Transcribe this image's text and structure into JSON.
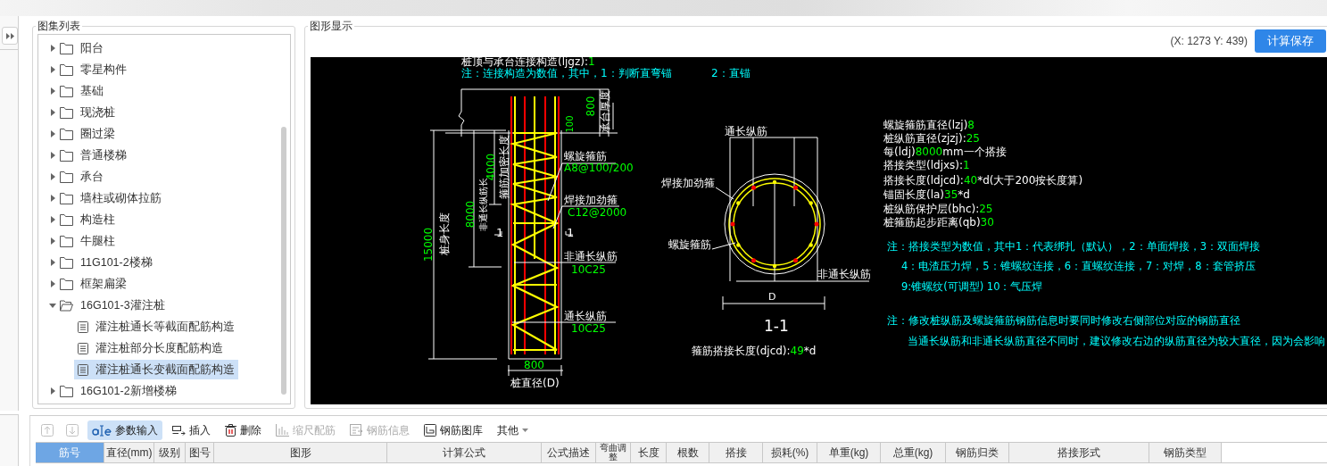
{
  "tree_panel": {
    "title": "图集列表",
    "items": [
      {
        "label": "阳台",
        "expanded": false,
        "selected": false
      },
      {
        "label": "零星构件",
        "expanded": false,
        "selected": false
      },
      {
        "label": "基础",
        "expanded": false,
        "selected": false
      },
      {
        "label": "现浇桩",
        "expanded": false,
        "selected": false
      },
      {
        "label": "圈过梁",
        "expanded": false,
        "selected": false
      },
      {
        "label": "普通楼梯",
        "expanded": false,
        "selected": false
      },
      {
        "label": "承台",
        "expanded": false,
        "selected": false
      },
      {
        "label": "墙柱或砌体拉筋",
        "expanded": false,
        "selected": false
      },
      {
        "label": "构造柱",
        "expanded": false,
        "selected": false
      },
      {
        "label": "牛腿柱",
        "expanded": false,
        "selected": false
      },
      {
        "label": "11G101-2楼梯",
        "expanded": false,
        "selected": false
      },
      {
        "label": "框架扁梁",
        "expanded": false,
        "selected": false
      },
      {
        "label": "16G101-3灌注桩",
        "expanded": true,
        "selected": false,
        "children": [
          {
            "label": "灌注桩通长等截面配筋构造",
            "selected": false
          },
          {
            "label": "灌注桩部分长度配筋构造",
            "selected": false
          },
          {
            "label": "灌注桩通长变截面配筋构造",
            "selected": true
          }
        ]
      },
      {
        "label": "16G101-2新增楼梯",
        "expanded": false,
        "selected": false
      }
    ]
  },
  "graphic_panel": {
    "title": "图形显示",
    "coordinates": "(X: 1273 Y: 439)",
    "save_button": "计算保存",
    "drawing": {
      "top_param": {
        "label": "桩顶与承台连接构造(ljgz):",
        "value": "1"
      },
      "top_note": [
        "注：连接构造为数值，其中，1：判断直弯锚",
        "2：直锚"
      ],
      "elevation_labels": [
        {
          "text": "800",
          "kind": "dim"
        },
        {
          "text": "承台厚度",
          "kind": "text"
        },
        {
          "text": "100",
          "kind": "dim"
        },
        {
          "text": "箍筋加密长度",
          "kind": "text"
        },
        {
          "text": "4000",
          "kind": "dim"
        },
        {
          "text": "非通长纵筋长",
          "kind": "text"
        },
        {
          "text": "8000",
          "kind": "dim"
        },
        {
          "text": "桩身长度",
          "kind": "text"
        },
        {
          "text": "15000",
          "kind": "dim"
        },
        {
          "text": "螺旋箍筋",
          "kind": "text"
        },
        {
          "text": "A8@100/200",
          "kind": "dim"
        },
        {
          "text": "焊接加劲箍",
          "kind": "text"
        },
        {
          "text": "C12@2000",
          "kind": "dim"
        },
        {
          "text": "1",
          "kind": "text"
        },
        {
          "text": "1",
          "kind": "text"
        },
        {
          "text": "非通长纵筋",
          "kind": "text"
        },
        {
          "text": "10C25",
          "kind": "dim"
        },
        {
          "text": "通长纵筋",
          "kind": "text"
        },
        {
          "text": "10C25",
          "kind": "dim"
        },
        {
          "text": "800",
          "kind": "dim"
        },
        {
          "text": "桩直径(D)",
          "kind": "text"
        }
      ],
      "section_labels": [
        "通长纵筋",
        "焊接加劲箍",
        "螺旋箍筋",
        "非通长纵筋",
        "D",
        "1-1"
      ],
      "section_param": {
        "label": "箍筋搭接长度(djcd):",
        "value": "49",
        "suffix": "*d"
      },
      "parameters": [
        {
          "label": "螺旋箍筋直径(lzj)",
          "value": "8"
        },
        {
          "label": "桩纵筋直径(zjzj):",
          "value": "25"
        },
        {
          "label": "每(ldj)",
          "value": "8000",
          "suffix": "mm一个搭接"
        },
        {
          "label": "搭接类型(ldjxs):",
          "value": "1"
        },
        {
          "label": "搭接长度(ldjcd):",
          "value": "40",
          "suffix": "*d(大于200按长度算)"
        },
        {
          "label": "锚固长度(la)",
          "value": "35",
          "suffix": "*d"
        },
        {
          "label": "桩纵筋保护层(bhc):",
          "value": "25"
        },
        {
          "label": "桩箍筋起步距离(qb)",
          "value": "30"
        }
      ],
      "notes": [
        "注：搭接类型为数值，其中1：代表绑扎（默认），2：单面焊接，3：双面焊接",
        "4：电渣压力焊，5：锥螺纹连接，6：直螺纹连接，7：对焊，8：套管挤压",
        "9:锥螺纹(可调型) 10：气压焊",
        "注：修改桩纵筋及螺旋箍筋钢筋信息时要同时修改右侧部位对应的钢筋直径",
        "当通长纵筋和非通长纵筋直径不同时，建议修改右边的纵筋直径为较大直径，因为会影响"
      ]
    }
  },
  "toolbar": {
    "arrow_buttons": [
      {
        "disabled": true
      },
      {
        "disabled": true
      }
    ],
    "tools": [
      {
        "label": "参数输入",
        "selected": true,
        "disabled": false
      },
      {
        "label": "插入",
        "selected": false,
        "disabled": false
      },
      {
        "label": "删除",
        "selected": false,
        "disabled": false
      },
      {
        "label": "缩尺配筋",
        "selected": false,
        "disabled": true
      },
      {
        "label": "钢筋信息",
        "selected": false,
        "disabled": true
      },
      {
        "label": "钢筋图库",
        "selected": false,
        "disabled": false
      }
    ],
    "more_menu": "其他"
  },
  "table": {
    "columns": [
      {
        "label": "筋号",
        "selected": true
      },
      {
        "label": "直径(mm)",
        "selected": false
      },
      {
        "label": "级别",
        "selected": false
      },
      {
        "label": "图号",
        "selected": false
      },
      {
        "label": "图形",
        "selected": false
      },
      {
        "label": "计算公式",
        "selected": false
      },
      {
        "label": "公式描述",
        "selected": false
      },
      {
        "label": "弯曲调整",
        "selected": false
      },
      {
        "label": "长度",
        "selected": false
      },
      {
        "label": "根数",
        "selected": false
      },
      {
        "label": "搭接",
        "selected": false
      },
      {
        "label": "损耗(%)",
        "selected": false
      },
      {
        "label": "单重(kg)",
        "selected": false
      },
      {
        "label": "总重(kg)",
        "selected": false
      },
      {
        "label": "钢筋归类",
        "selected": false
      },
      {
        "label": "搭接形式",
        "selected": false
      },
      {
        "label": "钢筋类型",
        "selected": false
      }
    ]
  }
}
